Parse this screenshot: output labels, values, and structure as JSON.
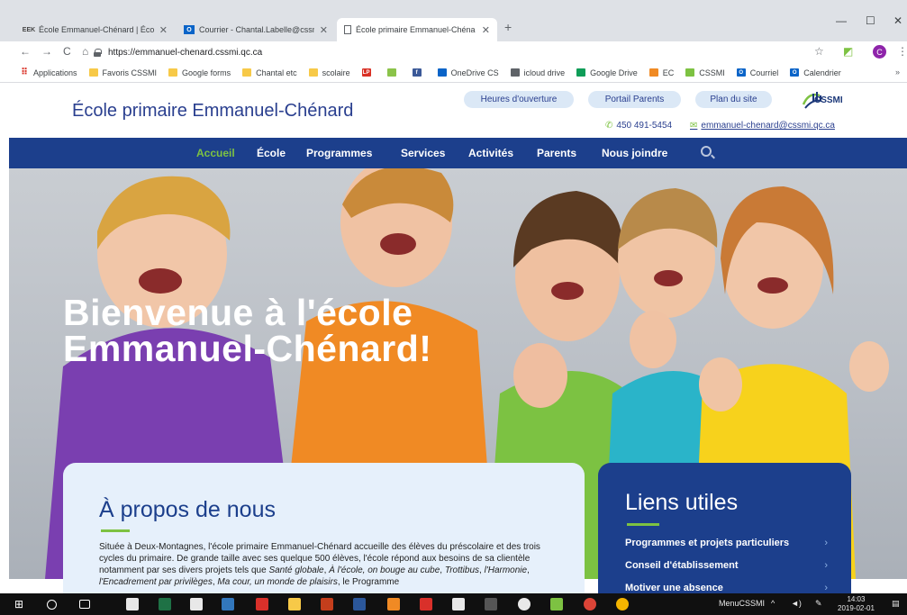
{
  "browser": {
    "tabs": [
      {
        "favicon": "EEK",
        "title": "École Emmanuel-Chénard | École"
      },
      {
        "favicon": "outlook-icon",
        "title": "Courrier - Chantal.Labelle@cssm"
      },
      {
        "favicon": "page-icon",
        "title": "École primaire Emmanuel-Chéna"
      }
    ],
    "url": "https://emmanuel-chenard.cssmi.qc.ca",
    "profile_initial": "C",
    "bookmarks": [
      {
        "icon": "apps-grid-icon",
        "label": "Applications"
      },
      {
        "icon": "folder-icon",
        "label": "Favoris CSSMI"
      },
      {
        "icon": "folder-icon",
        "label": "Google forms"
      },
      {
        "icon": "folder-icon",
        "label": "Chantal etc"
      },
      {
        "icon": "folder-icon",
        "label": "scolaire"
      },
      {
        "icon": "lp-icon",
        "label": ""
      },
      {
        "icon": "leaf-icon",
        "label": ""
      },
      {
        "icon": "facebook-icon",
        "label": ""
      },
      {
        "icon": "cloud-icon",
        "label": "OneDrive CS"
      },
      {
        "icon": "apple-icon",
        "label": "icloud drive"
      },
      {
        "icon": "drive-icon",
        "label": "Google Drive"
      },
      {
        "icon": "ec-icon",
        "label": "EC"
      },
      {
        "icon": "cssmi-icon",
        "label": "CSSMI"
      },
      {
        "icon": "outlook-icon",
        "label": "Courriel"
      },
      {
        "icon": "outlook-icon",
        "label": "Calendrier"
      }
    ],
    "bookmarks_more": "»"
  },
  "site": {
    "title": "École primaire Emmanuel-Chénard",
    "header_buttons": [
      "Heures d'ouverture",
      "Portail Parents",
      "Plan du site"
    ],
    "logo_text": "CSSMI",
    "phone": "450 491-5454",
    "email": "emmanuel-chenard@cssmi.qc.ca",
    "nav": [
      "Accueil",
      "École",
      "Programmes",
      "Services",
      "Activités",
      "Parents",
      "Nous joindre"
    ],
    "nav_active": 0,
    "hero": {
      "line1": "Bienvenue à l'école",
      "line2": "Emmanuel-Chénard!"
    },
    "about": {
      "title": "À propos de nous",
      "text_parts": [
        {
          "t": "Située à Deux-Montagnes, l'école primaire Emmanuel-Chénard accueille des élèves du préscolaire et des trois cycles du primaire. De grande taille avec ses quelque 500 élèves, l'école répond aux besoins de sa clientèle notamment par ses divers projets tels que ",
          "i": false
        },
        {
          "t": "Santé globale",
          "i": true
        },
        {
          "t": ", ",
          "i": false
        },
        {
          "t": "À l'école, on bouge au cube",
          "i": true
        },
        {
          "t": ", ",
          "i": false
        },
        {
          "t": "Trottibus",
          "i": true
        },
        {
          "t": ", ",
          "i": false
        },
        {
          "t": "l'Harmonie",
          "i": true
        },
        {
          "t": ", ",
          "i": false
        },
        {
          "t": "l'Encadrement par privilèges",
          "i": true
        },
        {
          "t": ", ",
          "i": false
        },
        {
          "t": "Ma cour, un monde de plaisirs",
          "i": true
        },
        {
          "t": ", le Programme",
          "i": false
        }
      ]
    },
    "links": {
      "title": "Liens utiles",
      "items": [
        "Programmes et projets particuliers",
        "Conseil d'établissement",
        "Motiver une absence"
      ],
      "chevron": "›"
    }
  },
  "taskbar": {
    "app_label": "MenuCSSMI",
    "time": "14:03",
    "date": "2019-02-01"
  },
  "colors": {
    "navy": "#1c3f8c",
    "green": "#7dc242",
    "light_blue": "#dbe8f6"
  }
}
